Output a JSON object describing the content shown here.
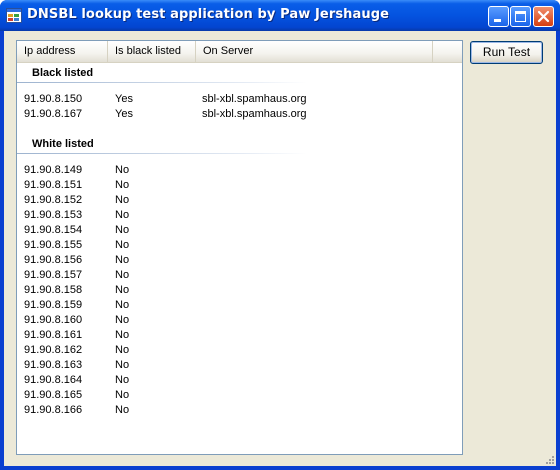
{
  "window": {
    "title": "DNSBL lookup test application by Paw Jershauge"
  },
  "list": {
    "columns": [
      "Ip address",
      "Is black listed",
      "On Server"
    ],
    "groups": [
      {
        "label": "Black listed",
        "rows": [
          {
            "ip": "91.90.8.150",
            "listed": "Yes",
            "server": "sbl-xbl.spamhaus.org"
          },
          {
            "ip": "91.90.8.167",
            "listed": "Yes",
            "server": "sbl-xbl.spamhaus.org"
          }
        ]
      },
      {
        "label": "White listed",
        "rows": [
          {
            "ip": "91.90.8.149",
            "listed": "No",
            "server": ""
          },
          {
            "ip": "91.90.8.151",
            "listed": "No",
            "server": ""
          },
          {
            "ip": "91.90.8.152",
            "listed": "No",
            "server": ""
          },
          {
            "ip": "91.90.8.153",
            "listed": "No",
            "server": ""
          },
          {
            "ip": "91.90.8.154",
            "listed": "No",
            "server": ""
          },
          {
            "ip": "91.90.8.155",
            "listed": "No",
            "server": ""
          },
          {
            "ip": "91.90.8.156",
            "listed": "No",
            "server": ""
          },
          {
            "ip": "91.90.8.157",
            "listed": "No",
            "server": ""
          },
          {
            "ip": "91.90.8.158",
            "listed": "No",
            "server": ""
          },
          {
            "ip": "91.90.8.159",
            "listed": "No",
            "server": ""
          },
          {
            "ip": "91.90.8.160",
            "listed": "No",
            "server": ""
          },
          {
            "ip": "91.90.8.161",
            "listed": "No",
            "server": ""
          },
          {
            "ip": "91.90.8.162",
            "listed": "No",
            "server": ""
          },
          {
            "ip": "91.90.8.163",
            "listed": "No",
            "server": ""
          },
          {
            "ip": "91.90.8.164",
            "listed": "No",
            "server": ""
          },
          {
            "ip": "91.90.8.165",
            "listed": "No",
            "server": ""
          },
          {
            "ip": "91.90.8.166",
            "listed": "No",
            "server": ""
          }
        ]
      }
    ]
  },
  "buttons": {
    "run_test": "Run Test"
  },
  "icons": {
    "app": "app-window-icon",
    "minimize": "minimize-icon",
    "maximize": "maximize-icon",
    "close": "close-icon",
    "size_grip": "size-grip-icon"
  },
  "colors": {
    "titlebar": "#0453e0",
    "client_bg": "#ece9d8",
    "list_border": "#7f9db9",
    "close_button": "#d63e10"
  }
}
